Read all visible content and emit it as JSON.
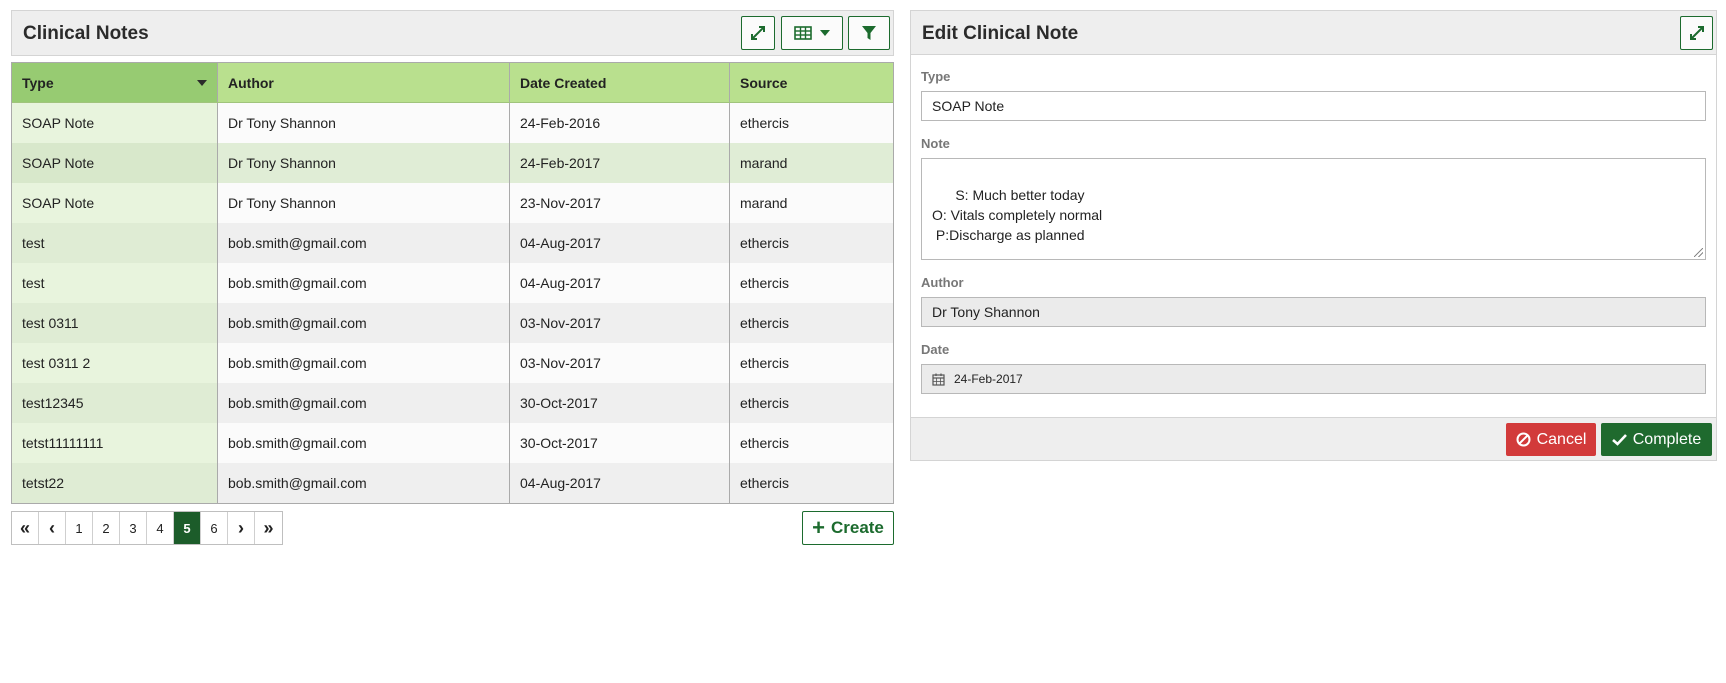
{
  "left_panel": {
    "title": "Clinical Notes",
    "buttons": {
      "expand_icon": "expand-icon",
      "table_icon": "table-icon",
      "filter_icon": "filter-icon"
    },
    "columns": [
      "Type",
      "Author",
      "Date Created",
      "Source"
    ],
    "sort_column": "Type",
    "rows": [
      {
        "type": "SOAP Note",
        "author": "Dr Tony Shannon",
        "date": "24-Feb-2016",
        "source": "ethercis"
      },
      {
        "type": "SOAP Note",
        "author": "Dr Tony Shannon",
        "date": "24-Feb-2017",
        "source": "marand"
      },
      {
        "type": "SOAP Note",
        "author": "Dr Tony Shannon",
        "date": "23-Nov-2017",
        "source": "marand"
      },
      {
        "type": "test",
        "author": "bob.smith@gmail.com",
        "date": "04-Aug-2017",
        "source": "ethercis"
      },
      {
        "type": "test",
        "author": "bob.smith@gmail.com",
        "date": "04-Aug-2017",
        "source": "ethercis"
      },
      {
        "type": "test 0311",
        "author": "bob.smith@gmail.com",
        "date": "03-Nov-2017",
        "source": "ethercis"
      },
      {
        "type": "test 0311 2",
        "author": "bob.smith@gmail.com",
        "date": "03-Nov-2017",
        "source": "ethercis"
      },
      {
        "type": "test12345",
        "author": "bob.smith@gmail.com",
        "date": "30-Oct-2017",
        "source": "ethercis"
      },
      {
        "type": "tetst11111111",
        "author": "bob.smith@gmail.com",
        "date": "30-Oct-2017",
        "source": "ethercis"
      },
      {
        "type": "tetst22",
        "author": "bob.smith@gmail.com",
        "date": "04-Aug-2017",
        "source": "ethercis"
      }
    ],
    "selected_row": 1,
    "pagination": {
      "first": "«",
      "prev": "‹",
      "pages": [
        "1",
        "2",
        "3",
        "4",
        "5",
        "6"
      ],
      "active_page": "5",
      "next": "›",
      "last": "»"
    },
    "create_label": "Create"
  },
  "right_panel": {
    "title": "Edit Clinical Note",
    "type_label": "Type",
    "type_value": "SOAP Note",
    "note_label": "Note",
    "note_value": "S: Much better today\nO: Vitals completely normal\n P:Discharge as planned",
    "author_label": "Author",
    "author_value": "Dr Tony Shannon",
    "date_label": "Date",
    "date_value": "24-Feb-2017",
    "cancel_label": "Cancel",
    "complete_label": "Complete"
  },
  "colors": {
    "accent_green": "#1c6b2e",
    "header_green": "#b9e08e",
    "sorted_column_green": "#97cb72",
    "cancel_red": "#d23a3a",
    "complete_green": "#1f6a2e"
  }
}
